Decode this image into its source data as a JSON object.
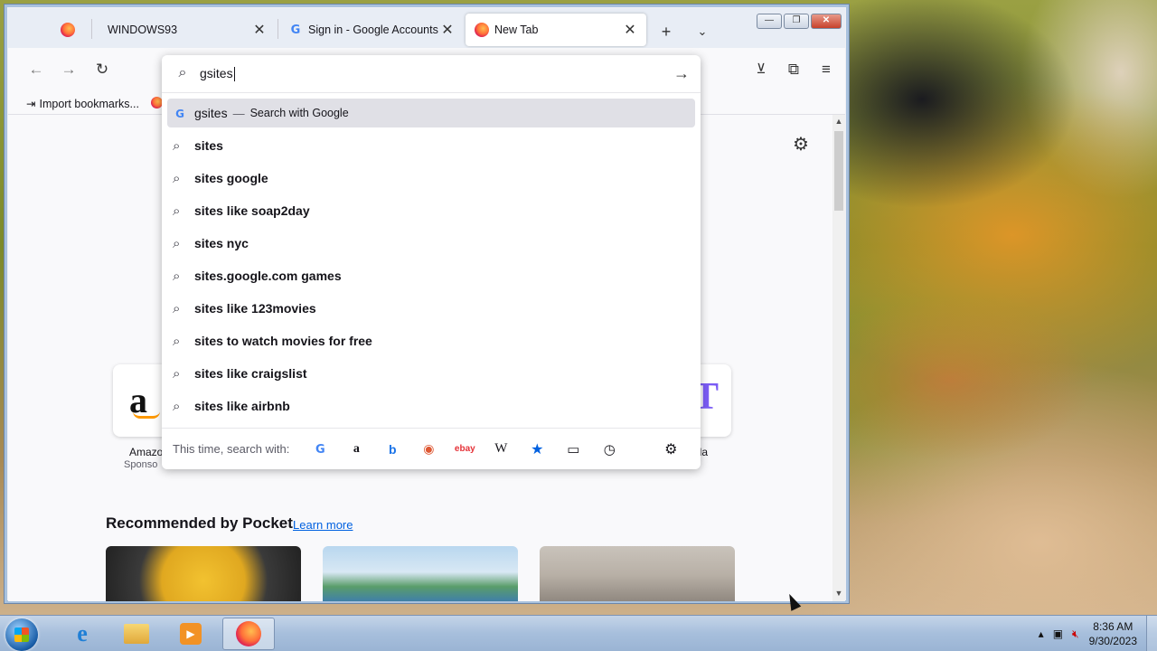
{
  "browser": {
    "tabs": [
      {
        "label": "",
        "icon": "firefox-icon"
      },
      {
        "label": "WINDOWS93",
        "icon": "none"
      },
      {
        "label": "Sign in - Google Accounts",
        "icon": "google-icon"
      },
      {
        "label": "New Tab",
        "icon": "firefox-icon",
        "active": true
      }
    ],
    "window_controls": {
      "minimize": "—",
      "restore": "❐",
      "close": "✕"
    }
  },
  "urlbar": {
    "value": "gsites",
    "heuristic": {
      "query": "gsites",
      "separator": "—",
      "engine_text": "Search with Google"
    },
    "suggestions": [
      "sites",
      "sites google",
      "sites like soap2day",
      "sites nyc",
      "sites.google.com games",
      "sites like 123movies",
      "sites to watch movies for free",
      "sites like craigslist",
      "sites like airbnb"
    ],
    "oneoff_label": "This time, search with:",
    "oneoff_engines": [
      "google",
      "amazon",
      "bing",
      "duckduckgo",
      "ebay",
      "wikipedia",
      "bookmarks",
      "tabs",
      "history"
    ]
  },
  "bookmarks": {
    "import_label": "Import bookmarks..."
  },
  "newtab": {
    "shortcut_left_label": "Amazo",
    "shortcut_left_sub": "Sponso",
    "shortcut_right_label": "lla",
    "pocket_title": "Recommended by Pocket",
    "pocket_link": "Learn more"
  },
  "taskbar": {
    "time": "8:36 AM",
    "date": "9/30/2023"
  }
}
